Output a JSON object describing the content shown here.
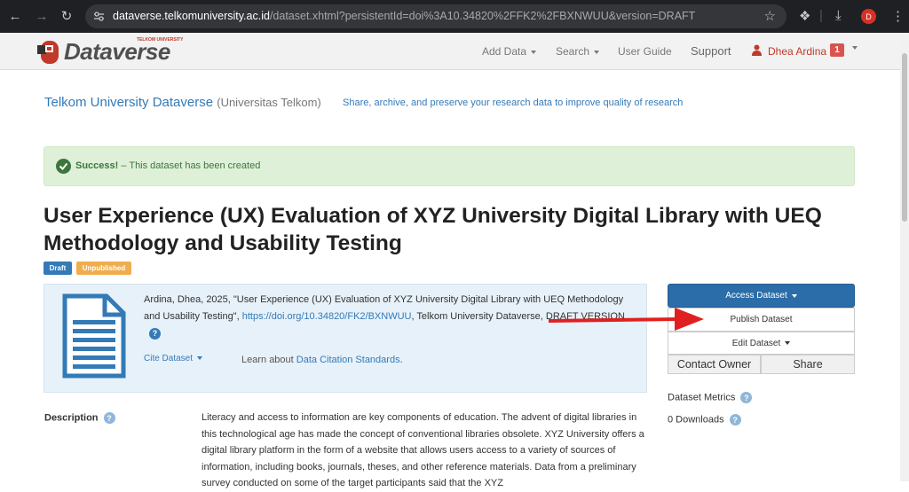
{
  "browser": {
    "url_host": "dataverse.telkomuniversity.ac.id",
    "url_path": "/dataset.xhtml?persistentId=doi%3A10.34820%2FFK2%2FBXNWUU&version=DRAFT",
    "profile_initial": "D"
  },
  "navbar": {
    "logo_text": "Dataverse",
    "logo_subtext": "TELKOM UNIVERSITY",
    "add_data": "Add Data",
    "search": "Search",
    "user_guide": "User Guide",
    "support": "Support",
    "user_name": "Dhea Ardina",
    "notification_count": "1"
  },
  "header": {
    "dataverse_name": "Telkom University Dataverse",
    "affiliation": "(Universitas Telkom)",
    "tagline": "Share, archive, and preserve your research data to improve quality of research"
  },
  "alert": {
    "strong": "Success!",
    "message": " – This dataset has been created"
  },
  "dataset": {
    "title": "User Experience (UX) Evaluation of XYZ University Digital Library with UEQ Methodology and Usability Testing",
    "label_draft": "Draft",
    "label_unpublished": "Unpublished",
    "citation_prefix": "Ardina, Dhea, 2025, \"User Experience (UX) Evaluation of XYZ University Digital Library with UEQ Methodology and Usability Testing\", ",
    "citation_doi": "https://doi.org/10.34820/FK2/BXNWUU",
    "citation_suffix": ", Telkom University Dataverse, DRAFT VERSION",
    "cite_dataset": "Cite Dataset",
    "learn_about": "Learn about ",
    "learn_link": "Data Citation Standards",
    "learn_end": "."
  },
  "actions": {
    "access_dataset": "Access Dataset",
    "publish_dataset": "Publish Dataset",
    "edit_dataset": "Edit Dataset",
    "contact_owner": "Contact Owner",
    "share": "Share"
  },
  "metrics": {
    "title": "Dataset Metrics",
    "downloads": "0 Downloads"
  },
  "description": {
    "label": "Description",
    "text": "Literacy and access to information are key components of education. The advent of digital libraries in this technological age has made the concept of conventional libraries obsolete. XYZ University offers a digital library platform in the form of a website that allows users access to a variety of sources of information, including books, journals, theses, and other reference materials. Data from a preliminary survey conducted on some of the target participants said that the XYZ"
  },
  "colors": {
    "link": "#337ab7",
    "success_bg": "#dff0d8",
    "arrow": "#e02020",
    "access_button": "#2b6da8"
  }
}
